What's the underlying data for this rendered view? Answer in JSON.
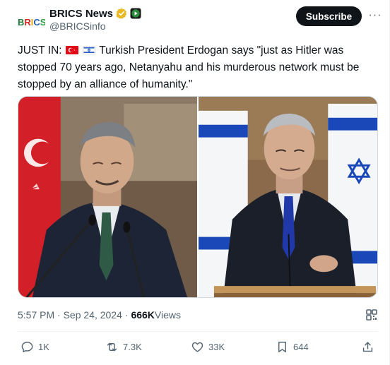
{
  "account": {
    "display_name": "BRICS News",
    "handle": "@BRICSinfo",
    "avatar_text": "BRICS",
    "verified_icon": "gold-verified-badge-icon",
    "affiliate_icon": "play-affiliate-badge-icon"
  },
  "header": {
    "subscribe_label": "Subscribe",
    "more_label": "···"
  },
  "tweet": {
    "prefix": "JUST IN: ",
    "flags": [
      "turkey-flag-icon",
      "israel-flag-icon"
    ],
    "body": " Turkish President Erdogan says \"just as Hitler was stopped 70 years ago, Netanyahu and his murderous network must be stopped by an alliance of humanity.\""
  },
  "meta": {
    "time": "5:57 PM · Sep 24, 2024 · ",
    "views_count": "666K",
    "views_label": " Views"
  },
  "actions": {
    "replies": "1K",
    "reposts": "7.3K",
    "likes": "33K",
    "bookmarks": "644"
  },
  "colors": {
    "text": "#0f1419",
    "secondary": "#536471",
    "subscribe_bg": "#0f1419",
    "verified_gold": "#e8b923",
    "affiliate_green": "#2c8c3c"
  }
}
